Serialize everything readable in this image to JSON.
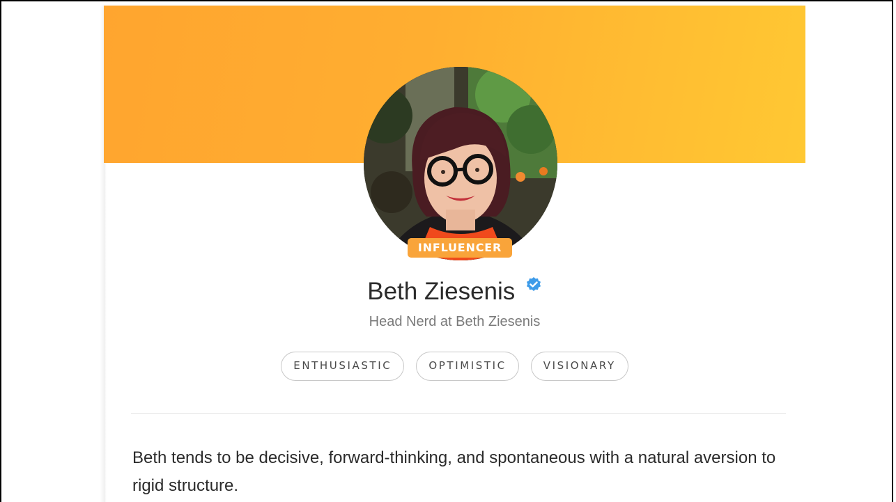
{
  "profile": {
    "badge": "INFLUENCER",
    "name": "Beth Ziesenis",
    "headline": "Head Nerd at Beth Ziesenis",
    "verified_icon": "verified-check-icon",
    "tags": [
      "ENTHUSIASTIC",
      "OPTIMISTIC",
      "VISIONARY"
    ],
    "description": "Beth tends to be decisive, forward-thinking, and spontaneous with a natural aversion to rigid structure."
  },
  "colors": {
    "banner_start": "#ffa52f",
    "banner_end": "#ffc833",
    "badge": "#f9a43a",
    "verified": "#3d9be9"
  }
}
